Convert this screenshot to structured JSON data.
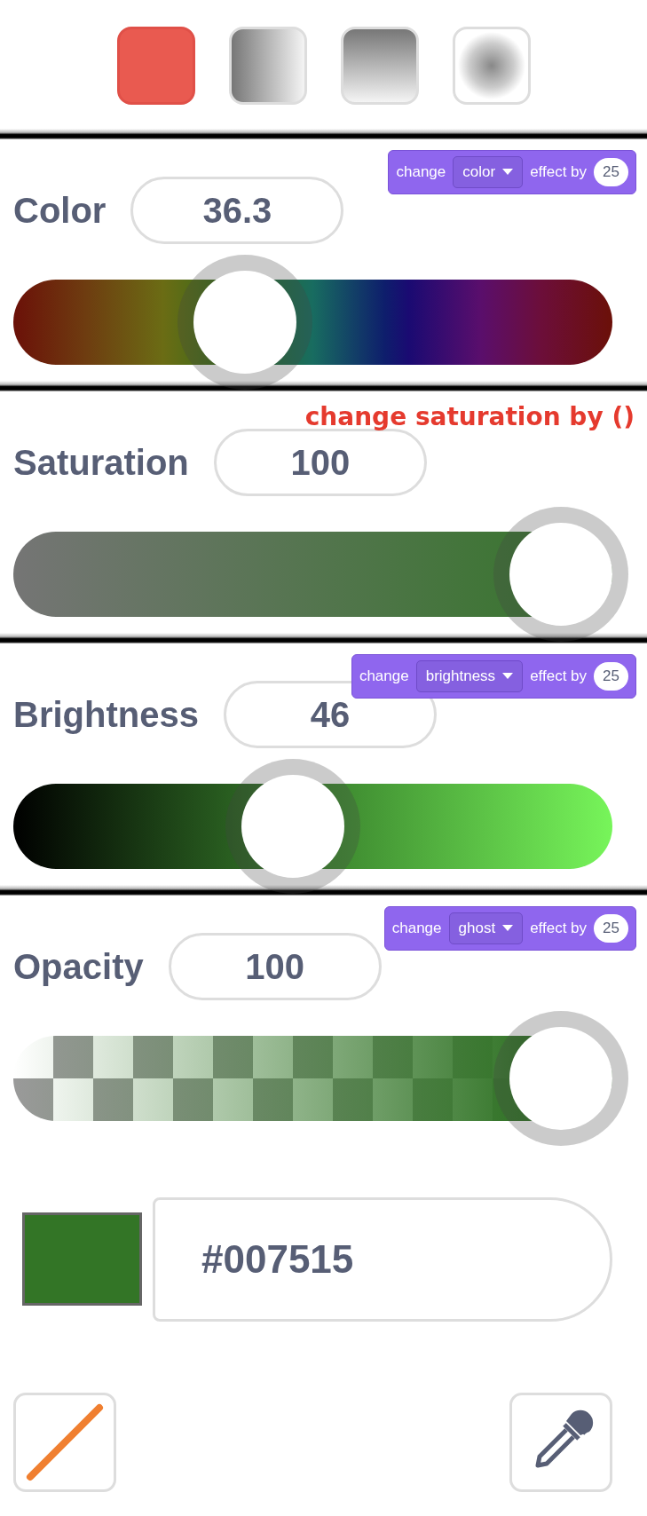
{
  "fill_types": [
    {
      "kind": "solid",
      "selected": true
    },
    {
      "kind": "horizontal",
      "selected": false
    },
    {
      "kind": "vertical",
      "selected": false
    },
    {
      "kind": "radial",
      "selected": false
    }
  ],
  "sliders": [
    {
      "kind": "color",
      "label": "Color",
      "value": "36.3",
      "level": 0.363,
      "block": {
        "verb": "change",
        "option": "color",
        "suffix": "effect by",
        "amount": "25"
      }
    },
    {
      "kind": "saturation",
      "label": "Saturation",
      "value": "100",
      "level": 1,
      "annotation": "change saturation by ()"
    },
    {
      "kind": "brightness",
      "label": "Brightness",
      "value": "46",
      "level": 0.46,
      "block": {
        "verb": "change",
        "option": "brightness",
        "suffix": "effect by",
        "amount": "25"
      }
    },
    {
      "kind": "opacity",
      "label": "Opacity",
      "value": "100",
      "level": 1,
      "block": {
        "verb": "change",
        "option": "ghost",
        "suffix": "effect by",
        "amount": "25"
      }
    }
  ],
  "hex": {
    "value": "#007515"
  },
  "tools": [
    {
      "kind": "line"
    },
    {
      "kind": "eyedropper"
    }
  ]
}
